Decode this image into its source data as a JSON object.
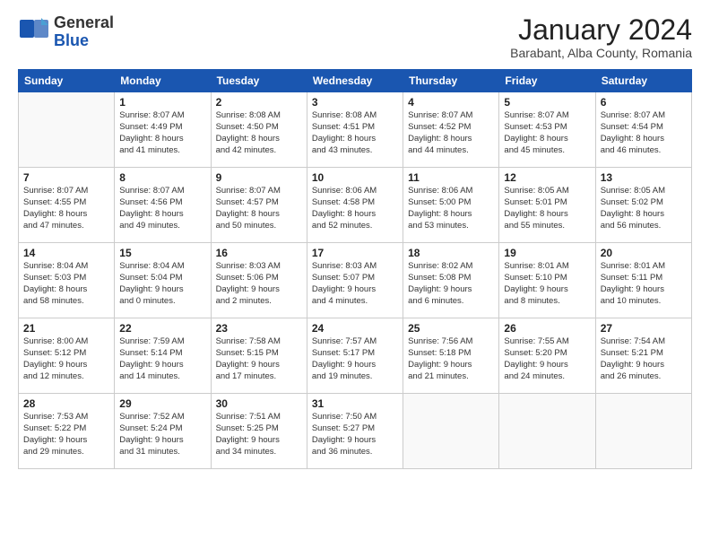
{
  "header": {
    "logo_general": "General",
    "logo_blue": "Blue",
    "month_title": "January 2024",
    "location": "Barabant, Alba County, Romania"
  },
  "weekdays": [
    "Sunday",
    "Monday",
    "Tuesday",
    "Wednesday",
    "Thursday",
    "Friday",
    "Saturday"
  ],
  "weeks": [
    [
      {
        "day": "",
        "lines": []
      },
      {
        "day": "1",
        "lines": [
          "Sunrise: 8:07 AM",
          "Sunset: 4:49 PM",
          "Daylight: 8 hours",
          "and 41 minutes."
        ]
      },
      {
        "day": "2",
        "lines": [
          "Sunrise: 8:08 AM",
          "Sunset: 4:50 PM",
          "Daylight: 8 hours",
          "and 42 minutes."
        ]
      },
      {
        "day": "3",
        "lines": [
          "Sunrise: 8:08 AM",
          "Sunset: 4:51 PM",
          "Daylight: 8 hours",
          "and 43 minutes."
        ]
      },
      {
        "day": "4",
        "lines": [
          "Sunrise: 8:07 AM",
          "Sunset: 4:52 PM",
          "Daylight: 8 hours",
          "and 44 minutes."
        ]
      },
      {
        "day": "5",
        "lines": [
          "Sunrise: 8:07 AM",
          "Sunset: 4:53 PM",
          "Daylight: 8 hours",
          "and 45 minutes."
        ]
      },
      {
        "day": "6",
        "lines": [
          "Sunrise: 8:07 AM",
          "Sunset: 4:54 PM",
          "Daylight: 8 hours",
          "and 46 minutes."
        ]
      }
    ],
    [
      {
        "day": "7",
        "lines": [
          "Sunrise: 8:07 AM",
          "Sunset: 4:55 PM",
          "Daylight: 8 hours",
          "and 47 minutes."
        ]
      },
      {
        "day": "8",
        "lines": [
          "Sunrise: 8:07 AM",
          "Sunset: 4:56 PM",
          "Daylight: 8 hours",
          "and 49 minutes."
        ]
      },
      {
        "day": "9",
        "lines": [
          "Sunrise: 8:07 AM",
          "Sunset: 4:57 PM",
          "Daylight: 8 hours",
          "and 50 minutes."
        ]
      },
      {
        "day": "10",
        "lines": [
          "Sunrise: 8:06 AM",
          "Sunset: 4:58 PM",
          "Daylight: 8 hours",
          "and 52 minutes."
        ]
      },
      {
        "day": "11",
        "lines": [
          "Sunrise: 8:06 AM",
          "Sunset: 5:00 PM",
          "Daylight: 8 hours",
          "and 53 minutes."
        ]
      },
      {
        "day": "12",
        "lines": [
          "Sunrise: 8:05 AM",
          "Sunset: 5:01 PM",
          "Daylight: 8 hours",
          "and 55 minutes."
        ]
      },
      {
        "day": "13",
        "lines": [
          "Sunrise: 8:05 AM",
          "Sunset: 5:02 PM",
          "Daylight: 8 hours",
          "and 56 minutes."
        ]
      }
    ],
    [
      {
        "day": "14",
        "lines": [
          "Sunrise: 8:04 AM",
          "Sunset: 5:03 PM",
          "Daylight: 8 hours",
          "and 58 minutes."
        ]
      },
      {
        "day": "15",
        "lines": [
          "Sunrise: 8:04 AM",
          "Sunset: 5:04 PM",
          "Daylight: 9 hours",
          "and 0 minutes."
        ]
      },
      {
        "day": "16",
        "lines": [
          "Sunrise: 8:03 AM",
          "Sunset: 5:06 PM",
          "Daylight: 9 hours",
          "and 2 minutes."
        ]
      },
      {
        "day": "17",
        "lines": [
          "Sunrise: 8:03 AM",
          "Sunset: 5:07 PM",
          "Daylight: 9 hours",
          "and 4 minutes."
        ]
      },
      {
        "day": "18",
        "lines": [
          "Sunrise: 8:02 AM",
          "Sunset: 5:08 PM",
          "Daylight: 9 hours",
          "and 6 minutes."
        ]
      },
      {
        "day": "19",
        "lines": [
          "Sunrise: 8:01 AM",
          "Sunset: 5:10 PM",
          "Daylight: 9 hours",
          "and 8 minutes."
        ]
      },
      {
        "day": "20",
        "lines": [
          "Sunrise: 8:01 AM",
          "Sunset: 5:11 PM",
          "Daylight: 9 hours",
          "and 10 minutes."
        ]
      }
    ],
    [
      {
        "day": "21",
        "lines": [
          "Sunrise: 8:00 AM",
          "Sunset: 5:12 PM",
          "Daylight: 9 hours",
          "and 12 minutes."
        ]
      },
      {
        "day": "22",
        "lines": [
          "Sunrise: 7:59 AM",
          "Sunset: 5:14 PM",
          "Daylight: 9 hours",
          "and 14 minutes."
        ]
      },
      {
        "day": "23",
        "lines": [
          "Sunrise: 7:58 AM",
          "Sunset: 5:15 PM",
          "Daylight: 9 hours",
          "and 17 minutes."
        ]
      },
      {
        "day": "24",
        "lines": [
          "Sunrise: 7:57 AM",
          "Sunset: 5:17 PM",
          "Daylight: 9 hours",
          "and 19 minutes."
        ]
      },
      {
        "day": "25",
        "lines": [
          "Sunrise: 7:56 AM",
          "Sunset: 5:18 PM",
          "Daylight: 9 hours",
          "and 21 minutes."
        ]
      },
      {
        "day": "26",
        "lines": [
          "Sunrise: 7:55 AM",
          "Sunset: 5:20 PM",
          "Daylight: 9 hours",
          "and 24 minutes."
        ]
      },
      {
        "day": "27",
        "lines": [
          "Sunrise: 7:54 AM",
          "Sunset: 5:21 PM",
          "Daylight: 9 hours",
          "and 26 minutes."
        ]
      }
    ],
    [
      {
        "day": "28",
        "lines": [
          "Sunrise: 7:53 AM",
          "Sunset: 5:22 PM",
          "Daylight: 9 hours",
          "and 29 minutes."
        ]
      },
      {
        "day": "29",
        "lines": [
          "Sunrise: 7:52 AM",
          "Sunset: 5:24 PM",
          "Daylight: 9 hours",
          "and 31 minutes."
        ]
      },
      {
        "day": "30",
        "lines": [
          "Sunrise: 7:51 AM",
          "Sunset: 5:25 PM",
          "Daylight: 9 hours",
          "and 34 minutes."
        ]
      },
      {
        "day": "31",
        "lines": [
          "Sunrise: 7:50 AM",
          "Sunset: 5:27 PM",
          "Daylight: 9 hours",
          "and 36 minutes."
        ]
      },
      {
        "day": "",
        "lines": []
      },
      {
        "day": "",
        "lines": []
      },
      {
        "day": "",
        "lines": []
      }
    ]
  ]
}
